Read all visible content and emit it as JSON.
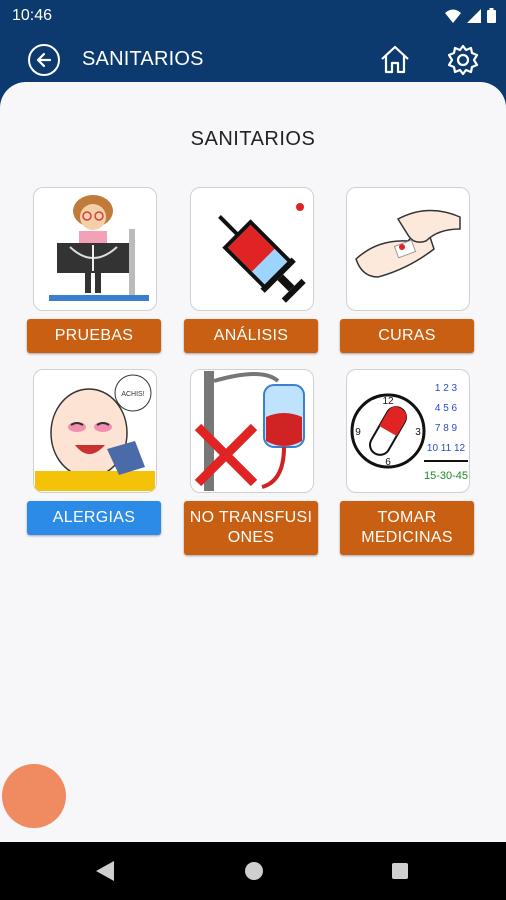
{
  "status_bar": {
    "time": "10:46"
  },
  "app_bar": {
    "title": "SANITARIOS"
  },
  "main": {
    "section_title": "SANITARIOS",
    "tiles": [
      {
        "label": "PRUEBAS",
        "icon": "xray-icon"
      },
      {
        "label": "ANÁLISIS",
        "icon": "syringe-icon"
      },
      {
        "label": "CURAS",
        "icon": "bandage-icon"
      },
      {
        "label": "ALERGIAS",
        "icon": "sneeze-icon"
      },
      {
        "label": "NO TRANSFUSI ONES",
        "icon": "no-transfusion-icon"
      },
      {
        "label": "TOMAR MEDICINAS",
        "icon": "pill-clock-icon"
      }
    ],
    "clock_calendar": {
      "numbers": [
        "1 2 3",
        "4 5 6",
        "7 8 9",
        "10 11 12"
      ],
      "bottom": "15-30-45"
    },
    "sneeze_bubble": "ACHIS!"
  },
  "colors": {
    "header": "#0c3a6e",
    "label_orange": "#c95f12",
    "label_blue": "#2b8be6",
    "fab": "#f08a60"
  }
}
